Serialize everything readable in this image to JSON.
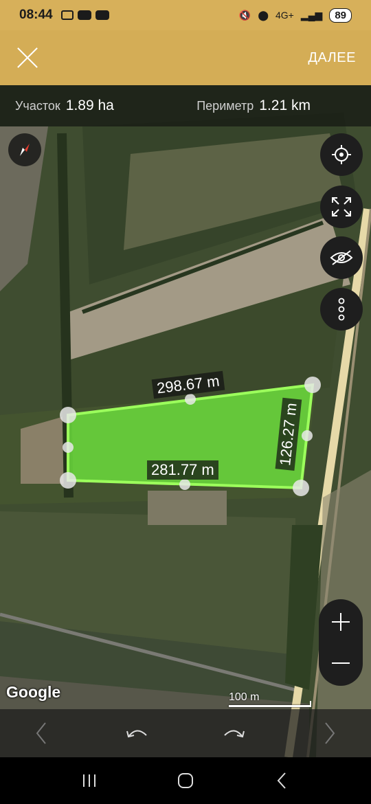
{
  "status": {
    "time": "08:44",
    "network": "4G+",
    "battery": "89"
  },
  "header": {
    "next_label": "ДАЛЕЕ"
  },
  "info": {
    "area_label": "Участок",
    "area_value": "1.89 ha",
    "perimeter_label": "Периметр",
    "perimeter_value": "1.21 km"
  },
  "measurements": {
    "top_edge": "298.67 m",
    "right_edge": "126.27 m",
    "bottom_edge": "281.77 m"
  },
  "map": {
    "attribution": "Google",
    "scale": "100 m",
    "polygon_fill": "#6bdc3c",
    "polygon_stroke": "#9cff5c"
  },
  "icons": {
    "close": "close-icon",
    "compass": "compass-icon",
    "locate": "my-location-icon",
    "fullscreen": "fullscreen-icon",
    "visibility": "visibility-off-icon",
    "more": "more-vertical-icon",
    "zoom_in": "plus-icon",
    "zoom_out": "minus-icon",
    "undo": "undo-icon",
    "redo": "redo-icon"
  }
}
